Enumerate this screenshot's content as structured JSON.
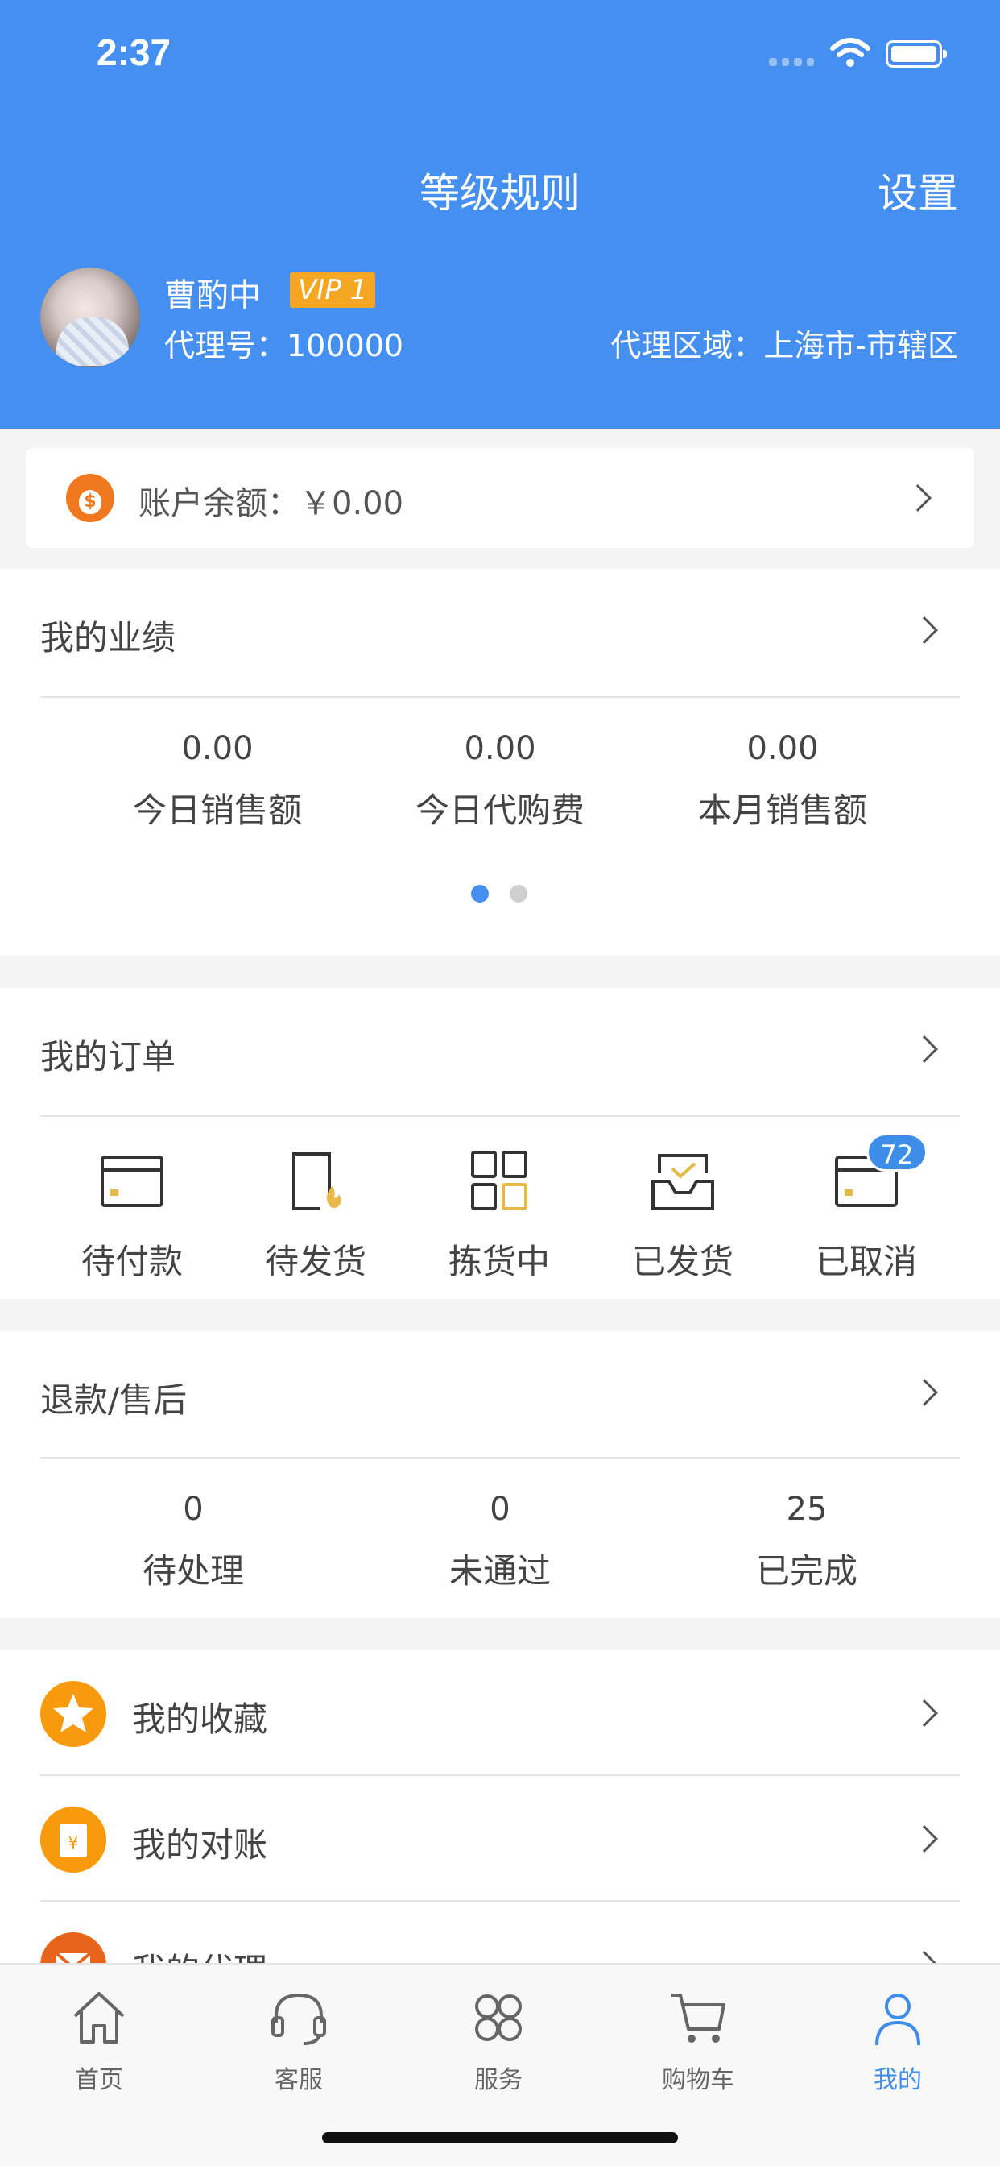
{
  "status_bar": {
    "time": "2:37"
  },
  "header": {
    "title": "等级规则",
    "settings_label": "设置",
    "user_name": "曹酌中",
    "vip_level": "VIP 1",
    "agent_no": "代理号：100000",
    "agent_region": "代理区域：上海市-市辖区"
  },
  "balance": {
    "label": "账户余额：￥0.00"
  },
  "performance": {
    "title": "我的业绩",
    "stats": [
      {
        "value": "0.00",
        "label": "今日销售额"
      },
      {
        "value": "0.00",
        "label": "今日代购费"
      },
      {
        "value": "0.00",
        "label": "本月销售额"
      }
    ],
    "page_dots": {
      "count": 2,
      "active": 0
    }
  },
  "orders": {
    "title": "我的订单",
    "items": [
      {
        "label": "待付款",
        "icon": "card-icon"
      },
      {
        "label": "待发货",
        "icon": "tablet-fire-icon"
      },
      {
        "label": "拣货中",
        "icon": "grid-icon"
      },
      {
        "label": "已发货",
        "icon": "inbox-check-icon"
      },
      {
        "label": "已取消",
        "icon": "card-cancel-icon"
      }
    ],
    "cancelled_badge": "72"
  },
  "refunds": {
    "title": "退款/售后",
    "stats": [
      {
        "value": "0",
        "label": "待处理"
      },
      {
        "value": "0",
        "label": "未通过"
      },
      {
        "value": "25",
        "label": "已完成"
      }
    ]
  },
  "menu": [
    {
      "label": "我的收藏",
      "icon": "star-icon"
    },
    {
      "label": "我的对账",
      "icon": "bill-icon"
    },
    {
      "label": "我的代理",
      "icon": "mail-icon"
    }
  ],
  "tabbar": [
    {
      "label": "首页",
      "icon": "home-icon"
    },
    {
      "label": "客服",
      "icon": "headset-icon"
    },
    {
      "label": "服务",
      "icon": "apps-icon"
    },
    {
      "label": "购物车",
      "icon": "cart-icon"
    },
    {
      "label": "我的",
      "icon": "user-icon",
      "active": true
    }
  ],
  "colors": {
    "primary": "#448fef",
    "accent_orange": "#f79a0d",
    "vip_badge": "#f5a623",
    "gold_icon": "#e8b84a"
  }
}
